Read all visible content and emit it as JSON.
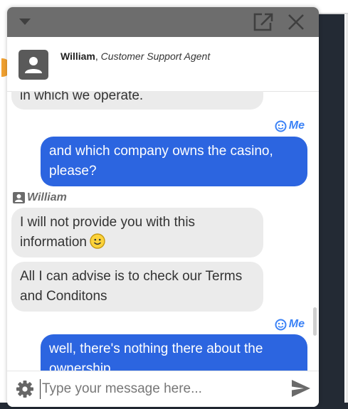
{
  "agent": {
    "name": "William",
    "role_separator": ", ",
    "role": "Customer Support Agent"
  },
  "messages": [
    {
      "from": "agent",
      "text": "in which we operate."
    },
    {
      "from": "me",
      "sender": "Me",
      "text": "and which company owns the casino, please?"
    },
    {
      "from": "agent",
      "sender": "William",
      "text": "I will not provide you with this information"
    },
    {
      "from": "agent",
      "text": "All I can advise is to check our Terms and Conditons"
    },
    {
      "from": "me",
      "sender": "Me",
      "text": "well, there's nothing there about the ownership"
    }
  ],
  "composer": {
    "placeholder": "Type your message here...",
    "value": ""
  },
  "icons": {
    "collapse": "chevron-down-icon",
    "popout": "open-in-new-window-icon",
    "close": "close-icon",
    "avatar": "person-icon",
    "me": "smiling-face-icon",
    "agent_badge": "contact-card-icon",
    "emoji": "smiley-emoji-icon",
    "settings": "gear-icon",
    "send": "send-arrow-icon"
  },
  "colors": {
    "titlebar": "#6d6d6d",
    "my_bubble": "#2c65e0",
    "agent_bubble": "#ebebeb",
    "my_sender": "#3b82f6",
    "agent_sender": "#6b6b6b"
  }
}
